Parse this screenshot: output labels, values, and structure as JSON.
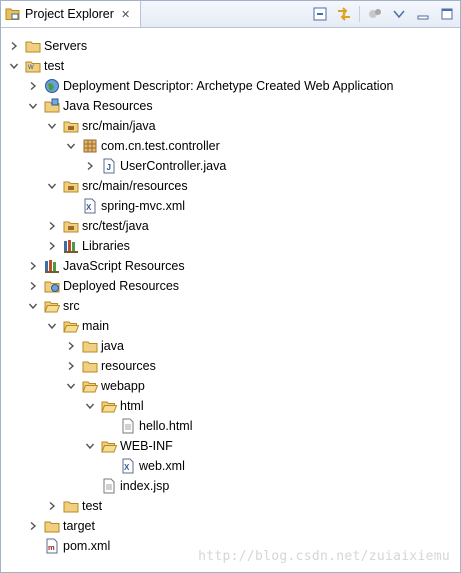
{
  "view": {
    "tab_title": "Project Explorer",
    "tab_close": "✕",
    "toolbar": [
      {
        "name": "collapse-all-icon"
      },
      {
        "name": "link-with-editor-icon"
      },
      {
        "name": "filters-icon"
      },
      {
        "name": "view-menu-icon"
      },
      {
        "name": "minimize-icon"
      },
      {
        "name": "maximize-icon"
      }
    ]
  },
  "tree": [
    {
      "label": "Servers",
      "depth": 0,
      "state": "collapsed",
      "icon": "folder"
    },
    {
      "label": "test",
      "depth": 0,
      "state": "expanded",
      "icon": "project"
    },
    {
      "label": "Deployment Descriptor: Archetype Created Web Application",
      "depth": 1,
      "state": "collapsed",
      "icon": "globe"
    },
    {
      "label": "Java Resources",
      "depth": 1,
      "state": "expanded",
      "icon": "java-resources"
    },
    {
      "label": "src/main/java",
      "depth": 2,
      "state": "expanded",
      "icon": "source-folder"
    },
    {
      "label": "com.cn.test.controller",
      "depth": 3,
      "state": "expanded",
      "icon": "package"
    },
    {
      "label": "UserController.java",
      "depth": 4,
      "state": "collapsed",
      "icon": "java-file"
    },
    {
      "label": "src/main/resources",
      "depth": 2,
      "state": "expanded",
      "icon": "source-folder"
    },
    {
      "label": "spring-mvc.xml",
      "depth": 3,
      "state": "leaf",
      "icon": "xml-file"
    },
    {
      "label": "src/test/java",
      "depth": 2,
      "state": "collapsed",
      "icon": "source-folder"
    },
    {
      "label": "Libraries",
      "depth": 2,
      "state": "collapsed",
      "icon": "library"
    },
    {
      "label": "JavaScript Resources",
      "depth": 1,
      "state": "collapsed",
      "icon": "library"
    },
    {
      "label": "Deployed Resources",
      "depth": 1,
      "state": "collapsed",
      "icon": "deployed"
    },
    {
      "label": "src",
      "depth": 1,
      "state": "expanded",
      "icon": "folder-open"
    },
    {
      "label": "main",
      "depth": 2,
      "state": "expanded",
      "icon": "folder-open"
    },
    {
      "label": "java",
      "depth": 3,
      "state": "collapsed",
      "icon": "folder"
    },
    {
      "label": "resources",
      "depth": 3,
      "state": "collapsed",
      "icon": "folder"
    },
    {
      "label": "webapp",
      "depth": 3,
      "state": "expanded",
      "icon": "folder-open"
    },
    {
      "label": "html",
      "depth": 4,
      "state": "expanded",
      "icon": "folder-open"
    },
    {
      "label": "hello.html",
      "depth": 5,
      "state": "leaf",
      "icon": "file"
    },
    {
      "label": "WEB-INF",
      "depth": 4,
      "state": "expanded",
      "icon": "folder-open"
    },
    {
      "label": "web.xml",
      "depth": 5,
      "state": "leaf",
      "icon": "xml-file"
    },
    {
      "label": "index.jsp",
      "depth": 4,
      "state": "leaf",
      "icon": "file"
    },
    {
      "label": "test",
      "depth": 2,
      "state": "collapsed",
      "icon": "folder"
    },
    {
      "label": "target",
      "depth": 1,
      "state": "collapsed",
      "icon": "folder"
    },
    {
      "label": "pom.xml",
      "depth": 1,
      "state": "leaf",
      "icon": "maven-file"
    }
  ],
  "watermark": "http://blog.csdn.net/zuiaixiemu",
  "colors": {
    "folder": "#e8c060",
    "folder_dark": "#b88a20",
    "java_blue": "#3a6ea5",
    "package": "#c8a040",
    "twisty": "#555555"
  }
}
